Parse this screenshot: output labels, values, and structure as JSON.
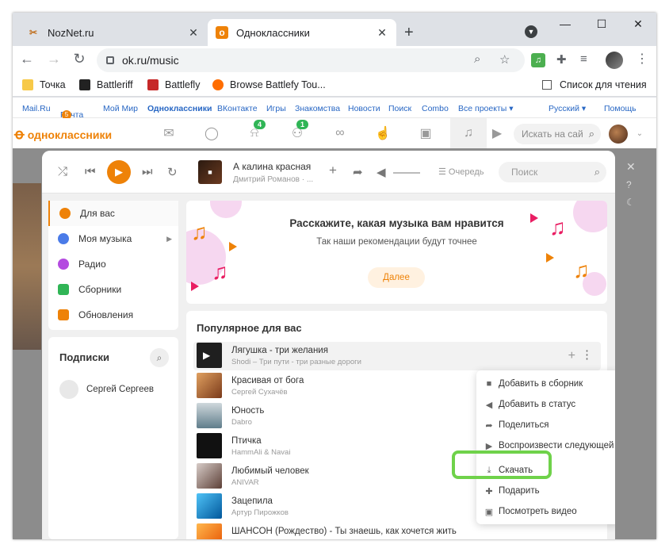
{
  "browser": {
    "tabs": [
      {
        "label": "NozNet.ru",
        "icon": "tools-icon",
        "active": false
      },
      {
        "label": "Одноклассники",
        "icon": "ok-icon",
        "active": true
      }
    ],
    "url": "ok.ru/music",
    "bookmarks": [
      "Точка",
      "Battleriff",
      "Battlefly",
      "Browse Battlefy Tou..."
    ],
    "reading_list": "Список для чтения"
  },
  "portal": {
    "links": [
      "Mail.Ru",
      "Почта",
      "Мой Мир",
      "Одноклассники",
      "ВКонтакте",
      "Игры",
      "Знакомства",
      "Новости",
      "Поиск",
      "Combo",
      "Все проекты ▾"
    ],
    "mail_badge": "5",
    "lang": "Русский ▾",
    "help": "Помощь"
  },
  "ok": {
    "logo": "одноклассники",
    "notif_badge": "4",
    "friends_badge": "1",
    "search_placeholder": "Искать на сай"
  },
  "player": {
    "title": "А калина красная",
    "artist": "Дмитрий Романов · ...",
    "queue": "Очередь",
    "search_placeholder": "Поиск"
  },
  "sidebar": {
    "items": [
      {
        "label": "Для вас",
        "color": "#ee8208"
      },
      {
        "label": "Моя музыка",
        "color": "#4a7be8"
      },
      {
        "label": "Радио",
        "color": "#b44be0"
      },
      {
        "label": "Сборники",
        "color": "#30b556"
      },
      {
        "label": "Обновления",
        "color": "#ee8208"
      }
    ]
  },
  "subscriptions": {
    "title": "Подписки",
    "items": [
      "Сергей Сергеев"
    ]
  },
  "promo": {
    "title": "Расскажите, какая музыка вам нравится",
    "subtitle": "Так наши рекомендации будут точнее",
    "button": "Далее"
  },
  "popular": {
    "title": "Популярное для вас",
    "tracks": [
      {
        "title": "Лягушка - три желания",
        "artist": "Shodi – Три пути - три разные дороги"
      },
      {
        "title": "Красивая от бога",
        "artist": "Сергей Сухачёв"
      },
      {
        "title": "Юность",
        "artist": "Dabro"
      },
      {
        "title": "Птичка",
        "artist": "HammAli & Navai"
      },
      {
        "title": "Любимый человек",
        "artist": "ANIVAR"
      },
      {
        "title": "Зацепила",
        "artist": "Артур Пирожков"
      },
      {
        "title": "ШАНСОН (Рождество) - Ты знаешь, как хочется жить",
        "artist": ""
      }
    ]
  },
  "context_menu": {
    "items": [
      {
        "label": "Добавить в сборник",
        "icon": "collection-icon"
      },
      {
        "label": "Добавить в статус",
        "icon": "status-icon"
      },
      {
        "label": "Поделиться",
        "icon": "share-icon"
      },
      {
        "label": "Воспроизвести следующей",
        "icon": "play-next-icon"
      },
      {
        "label": "Скачать",
        "icon": "download-icon"
      },
      {
        "label": "Подарить",
        "icon": "gift-icon"
      },
      {
        "label": "Посмотреть видео",
        "icon": "video-icon"
      }
    ]
  },
  "colors": {
    "accent": "#ee8208",
    "highlight": "#6fd24a"
  }
}
